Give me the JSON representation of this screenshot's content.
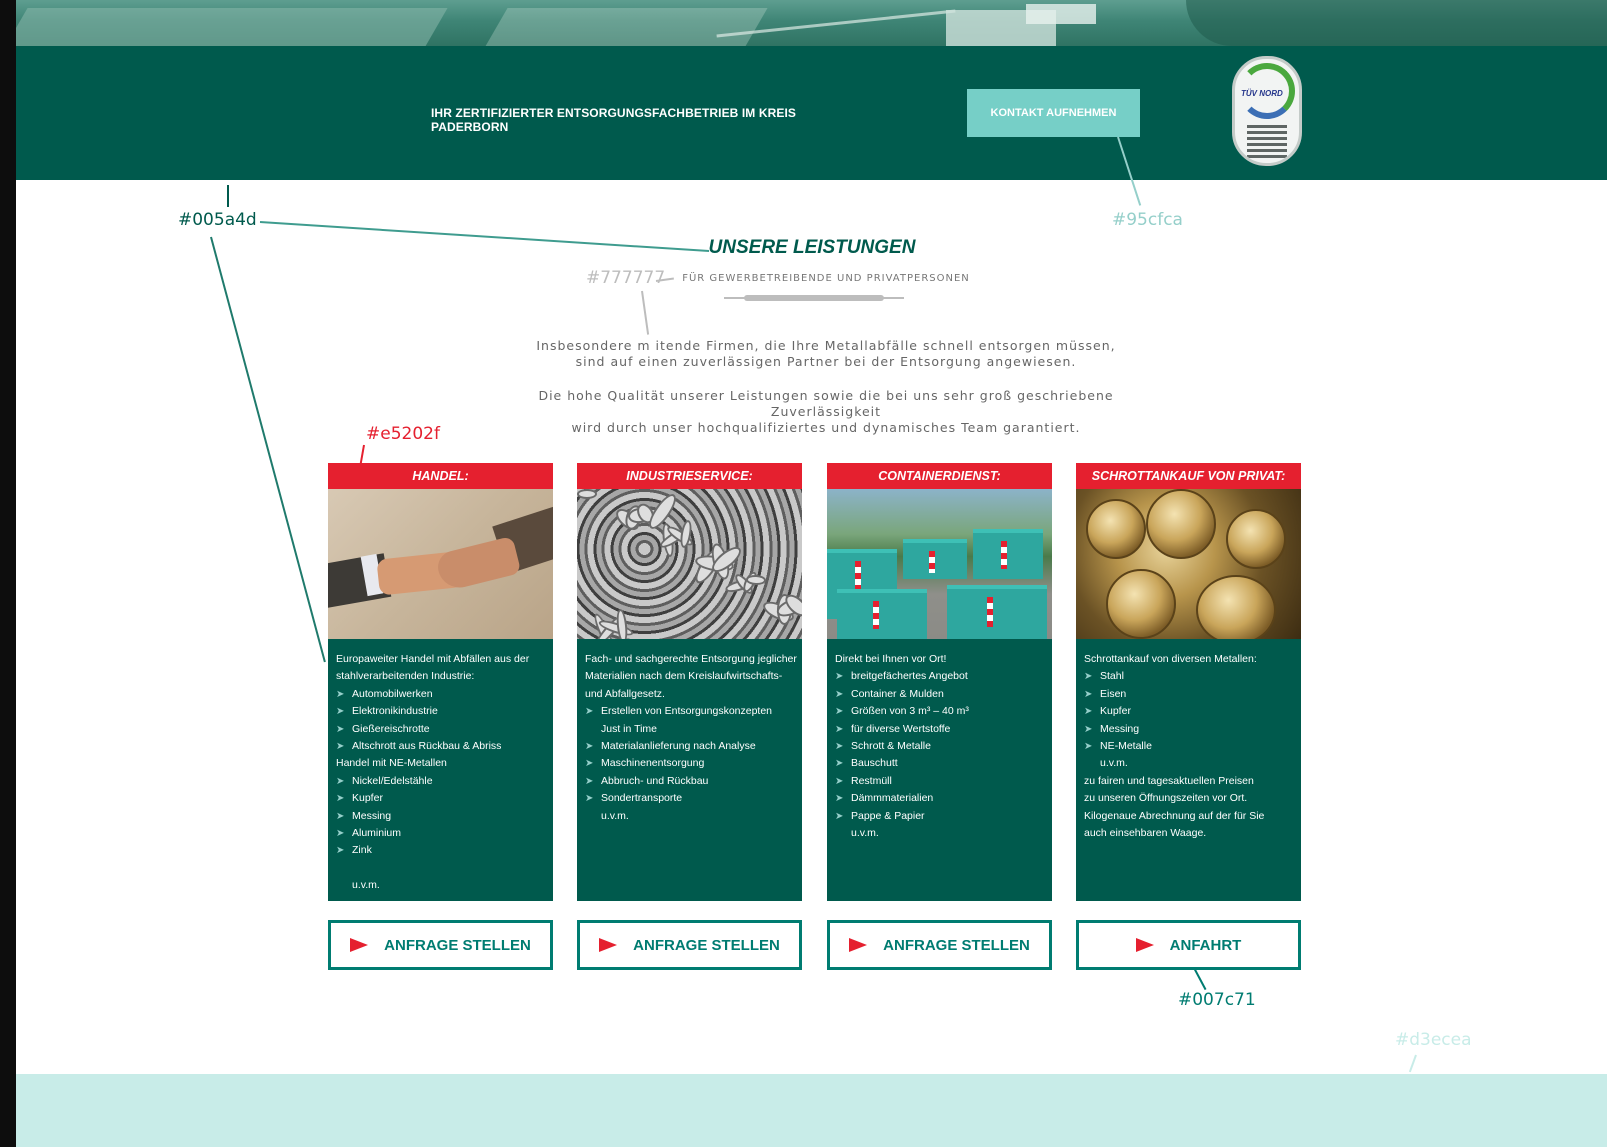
{
  "header": {
    "tagline": "IHR ZERTIFIZIERTER ENTSORGUNGSFACHBETRIEB IM KREIS PADERBORN",
    "contact_button": "KONTAKT AUFNEHMEN",
    "badge_brand": "TÜV NORD"
  },
  "section": {
    "title": "UNSERE LEISTUNGEN",
    "subtitle": "FÜR GEWERBETREIBENDE UND PRIVATPERSONEN",
    "paragraph1_line1": "Insbesondere m itende Firmen, die Ihre Metallabfälle schnell entsorgen müssen,",
    "paragraph1_line2": "sind auf einen zuverlässigen Partner bei der Entsorgung angewiesen.",
    "paragraph2_line1": "Die hohe Qualität unserer Leistungen sowie die bei uns sehr groß geschriebene Zuverlässigkeit",
    "paragraph2_line2": "wird durch unser hochqualifiziertes und dynamisches Team garantiert."
  },
  "cards": [
    {
      "title": "HANDEL:",
      "lines": [
        {
          "type": "text",
          "text": "Europaweiter Handel mit Abfällen aus der"
        },
        {
          "type": "text",
          "text": "stahlverarbeitenden Industrie:"
        },
        {
          "type": "bullet",
          "text": "Automobilwerken"
        },
        {
          "type": "bullet",
          "text": "Elektronikindustrie"
        },
        {
          "type": "bullet",
          "text": "Gießereischrotte"
        },
        {
          "type": "bullet",
          "text": "Altschrott aus Rückbau & Abriss"
        },
        {
          "type": "text",
          "text": "Handel mit NE-Metallen"
        },
        {
          "type": "bullet",
          "text": "Nickel/Edelstähle"
        },
        {
          "type": "bullet",
          "text": "Kupfer"
        },
        {
          "type": "bullet",
          "text": "Messing"
        },
        {
          "type": "bullet",
          "text": "Aluminium"
        },
        {
          "type": "bullet",
          "text": "Zink"
        },
        {
          "type": "gap",
          "text": ""
        },
        {
          "type": "indent",
          "text": "u.v.m."
        }
      ],
      "button": "ANFRAGE STELLEN"
    },
    {
      "title": "INDUSTRIESERVICE:",
      "lines": [
        {
          "type": "text",
          "text": "Fach- und sachgerechte Entsorgung jeglicher"
        },
        {
          "type": "text",
          "text": "Materialien nach dem Kreislaufwirtschafts-"
        },
        {
          "type": "text",
          "text": "und Abfallgesetz."
        },
        {
          "type": "bullet",
          "text": " Erstellen von Entsorgungskonzepten"
        },
        {
          "type": "indent",
          "text": "Just in Time"
        },
        {
          "type": "bullet",
          "text": "Materialanlieferung nach Analyse"
        },
        {
          "type": "bullet",
          "text": "Maschinenentsorgung"
        },
        {
          "type": "bullet",
          "text": "Abbruch- und Rückbau"
        },
        {
          "type": "bullet",
          "text": "Sondertransporte"
        },
        {
          "type": "indent",
          "text": "u.v.m."
        }
      ],
      "button": "ANFRAGE STELLEN"
    },
    {
      "title": "CONTAINERDIENST:",
      "lines": [
        {
          "type": "text",
          "text": "Direkt bei Ihnen vor Ort!"
        },
        {
          "type": "bullet",
          "text": "breitgefächertes Angebot"
        },
        {
          "type": "bullet",
          "text": "Container & Mulden"
        },
        {
          "type": "bullet",
          "text": "Größen von 3 m³ – 40 m³"
        },
        {
          "type": "bullet",
          "text": "für diverse Wertstoffe"
        },
        {
          "type": "bullet",
          "text": "Schrott & Metalle"
        },
        {
          "type": "bullet",
          "text": "Bauschutt"
        },
        {
          "type": "bullet",
          "text": "Restmüll"
        },
        {
          "type": "bullet",
          "text": "Dämmmaterialien"
        },
        {
          "type": "bullet",
          "text": "Pappe & Papier"
        },
        {
          "type": "indent",
          "text": "u.v.m."
        }
      ],
      "button": "ANFRAGE STELLEN"
    },
    {
      "title": "SCHROTTANKAUF VON PRIVAT:",
      "lines": [
        {
          "type": "text",
          "text": "Schrottankauf von diversen Metallen:"
        },
        {
          "type": "bullet",
          "text": "Stahl"
        },
        {
          "type": "bullet",
          "text": "Eisen"
        },
        {
          "type": "bullet",
          "text": "Kupfer"
        },
        {
          "type": "bullet",
          "text": "Messing"
        },
        {
          "type": "bullet",
          "text": "NE-Metalle"
        },
        {
          "type": "indent",
          "text": "u.v.m."
        },
        {
          "type": "text",
          "text": "zu fairen und tagesaktuellen Preisen"
        },
        {
          "type": "text",
          "text": "zu unseren Öffnungszeiten vor Ort."
        },
        {
          "type": "text",
          "text": "Kilogenaue Abrechnung auf der für Sie"
        },
        {
          "type": "text",
          "text": "auch einsehbaren Waage."
        }
      ],
      "button": "ANFAHRT"
    }
  ],
  "annotations": {
    "primary": "#005a4d",
    "accent_light": "#95cfca",
    "text_gray": "#777777",
    "red": "#e5202f",
    "button_green": "#007c71",
    "footer": "#d3ecea"
  },
  "colors": {
    "header_bg": "#005a4d",
    "contact_bg": "#76cfc7",
    "card_header_bg": "#e5202f",
    "card_body_bg": "#005a4d",
    "button_border": "#007c71",
    "footer_bg": "#c8ece8"
  },
  "icons": {
    "bullet": "arrow-bullet-icon",
    "button_arrow": "red-arrow-icon",
    "badge": "tuv-nord-certificate-icon"
  }
}
